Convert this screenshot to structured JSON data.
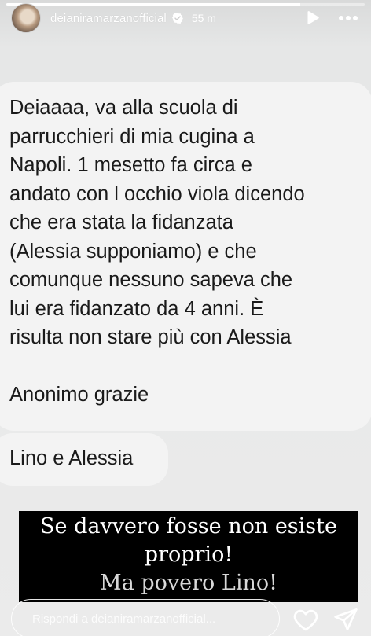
{
  "story": {
    "progress": 0.82
  },
  "header": {
    "avatar_icon": "profile-avatar",
    "username": "deianiramarzanofficial",
    "verified_icon": "verified-badge-icon",
    "time": "55 m",
    "play_icon": "play-icon",
    "more_icon": "more-horizontal-icon"
  },
  "message": {
    "main_lines": [
      "Deiaaaa, va alla scuola di",
      "parrucchieri di mia cugina a",
      "Napoli. 1 mesetto fa circa e",
      "andato con l occhio viola dicendo",
      "che era stata la fidanzata",
      "(Alessia supponiamo) e che",
      "comunque nessuno sapeva che",
      "lui era fidanzato da 4 anni. È",
      "risulta non stare più con Alessia"
    ],
    "signature": "Anonimo grazie",
    "second_bubble": "Lino e Alessia"
  },
  "caption": {
    "lines": [
      "Se davvero fosse non esiste",
      "proprio!",
      "Ma povero Lino!"
    ]
  },
  "reply_bar": {
    "placeholder": "Rispondi a deianiramarzanofficial...",
    "like_icon": "heart-icon",
    "share_icon": "send-icon"
  }
}
